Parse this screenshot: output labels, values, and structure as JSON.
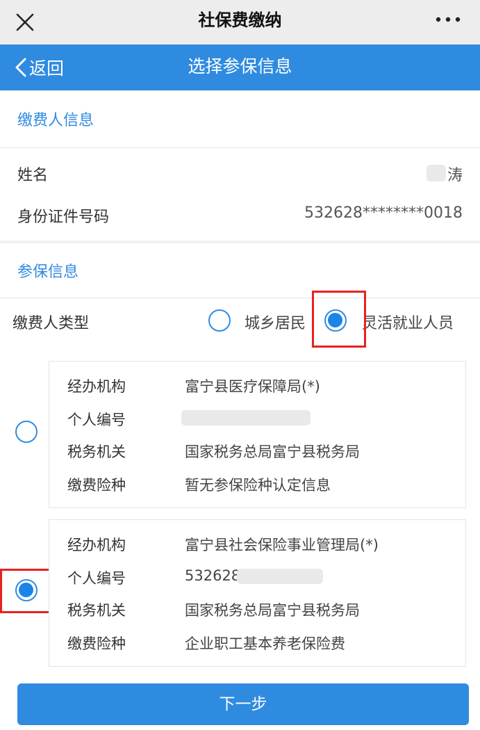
{
  "window": {
    "title": "社保费缴纳"
  },
  "nav": {
    "back_label": "返回",
    "title": "选择参保信息"
  },
  "payer_section": {
    "heading": "缴费人信息",
    "name_label": "姓名",
    "name_value": "涛",
    "id_label": "身份证件号码",
    "id_value": "532628********0018"
  },
  "insured_section": {
    "heading": "参保信息",
    "type_label": "缴费人类型",
    "options": [
      {
        "label": "城乡居民",
        "selected": false
      },
      {
        "label": "灵活就业人员",
        "selected": true
      }
    ]
  },
  "records": [
    {
      "selected": false,
      "agency_label": "经办机构",
      "agency": "富宁县医疗保障局(*)",
      "personal_no_label": "个人编号",
      "personal_no": "",
      "tax_label": "税务机关",
      "tax": "国家税务总局富宁县税务局",
      "insurance_label": "缴费险种",
      "insurance": "暂无参保险种认定信息"
    },
    {
      "selected": true,
      "agency_label": "经办机构",
      "agency": "富宁县社会保险事业管理局(*)",
      "personal_no_label": "个人编号",
      "personal_no": "532628",
      "tax_label": "税务机关",
      "tax": "国家税务总局富宁县税务局",
      "insurance_label": "缴费险种",
      "insurance": "企业职工基本养老保险费"
    }
  ],
  "next_button": "下一步",
  "colors": {
    "accent": "#2f8be0",
    "highlight": "#e8211f",
    "titlebar": "#ededed"
  },
  "icons": {
    "close": "close-icon",
    "more": "more-icon",
    "back": "chevron-left-icon"
  }
}
